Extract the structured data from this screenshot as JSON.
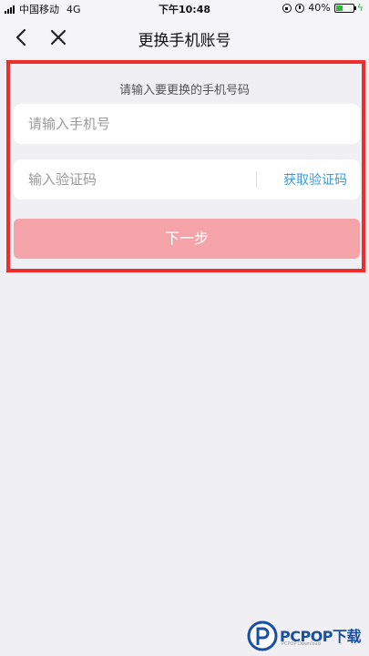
{
  "status_bar": {
    "carrier": "中国移动",
    "network": "4G",
    "time": "下午10:48",
    "battery": "40%",
    "battery_level": 0.4
  },
  "nav": {
    "title": "更换手机账号",
    "back_icon": "chevron-left-icon",
    "close_icon": "close-icon"
  },
  "form": {
    "hint": "请输入要更换的手机号码",
    "phone_placeholder": "请输入手机号",
    "phone_value": "",
    "code_placeholder": "输入验证码",
    "code_value": "",
    "get_code_label": "获取验证码",
    "next_label": "下一步"
  },
  "colors": {
    "highlight": "#ee2d2d",
    "accent_link": "#3a9ad9",
    "button_disabled": "#f4a3a8"
  },
  "watermark": {
    "text": "PCPOP下载",
    "sub": "PCPOP Download"
  }
}
